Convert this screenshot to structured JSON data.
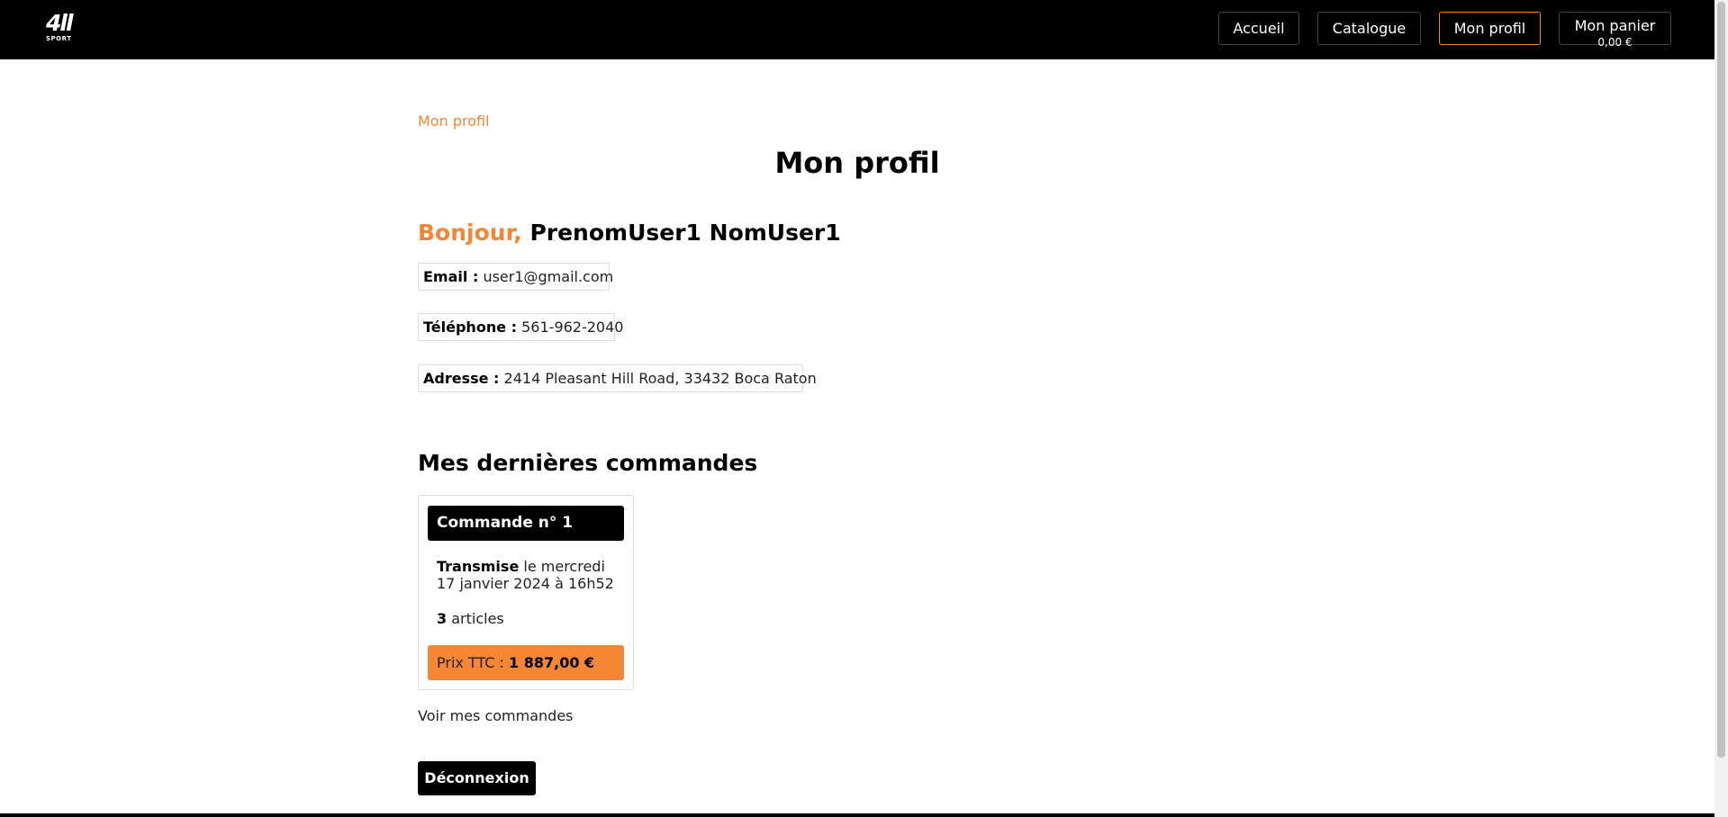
{
  "brand": {
    "logo_main": "4ll",
    "logo_sub": "SPORT"
  },
  "nav": {
    "accueil": "Accueil",
    "catalogue": "Catalogue",
    "profil": "Mon profil",
    "panier": "Mon panier",
    "panier_total": "0,00 €"
  },
  "breadcrumb": "Mon profil",
  "page_title": "Mon profil",
  "greeting": {
    "hello": "Bonjour,",
    "name": "PrenomUser1 NomUser1"
  },
  "profile": {
    "email_label": "Email :",
    "email": "user1@gmail.com",
    "phone_label": "Téléphone :",
    "phone": "561-962-2040",
    "address_label": "Adresse :",
    "address": "2414 Pleasant Hill Road, 33432 Boca Raton"
  },
  "orders_section_title": "Mes dernières commandes",
  "orders": [
    {
      "title": "Commande n° 1",
      "status": "Transmise",
      "date_text": "le mercredi 17 janvier 2024 à 16h52",
      "items_count": "3",
      "items_label": "articles",
      "price_label": "Prix TTC :",
      "price": "1 887,00 €"
    }
  ],
  "orders_link": "Voir mes commandes",
  "logout_label": "Déconnexion",
  "colors": {
    "accent": "#f58634",
    "header_bg": "#000000"
  }
}
